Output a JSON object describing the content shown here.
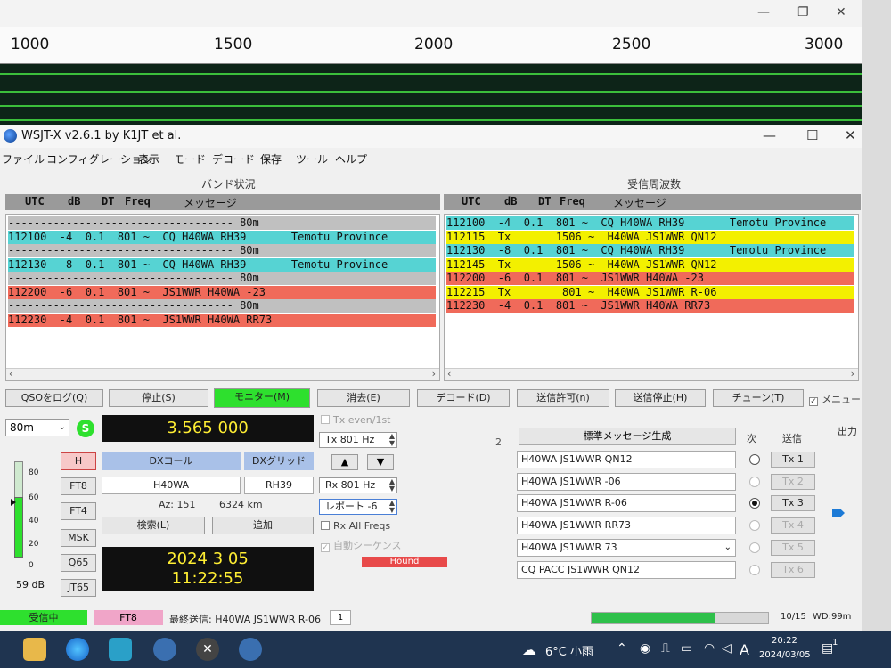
{
  "wide_graph": {
    "scale_labels": [
      "1000",
      "1500",
      "2000",
      "2500",
      "3000"
    ]
  },
  "app": {
    "title": "WSJT-X   v2.6.1   by K1JT et al."
  },
  "menu": [
    "ファイル",
    "コンフィグレーション",
    "表示",
    "モード",
    "デコード",
    "保存",
    "ツール",
    "ヘルプ"
  ],
  "band_activity": {
    "title": "バンド状況",
    "headers": {
      "utc": "UTC",
      "db": "dB",
      "dt": "DT",
      "freq": "Freq",
      "msg": "メッセージ"
    },
    "rows": [
      {
        "type": "sep",
        "text": "----------------------------------- 80m"
      },
      {
        "type": "cq",
        "text": "112100  -4  0.1  801 ~  CQ H40WA RH39       Temotu Province"
      },
      {
        "type": "sep",
        "text": "----------------------------------- 80m"
      },
      {
        "type": "cq",
        "text": "112130  -8  0.1  801 ~  CQ H40WA RH39       Temotu Province"
      },
      {
        "type": "sep",
        "text": "----------------------------------- 80m"
      },
      {
        "type": "me",
        "text": "112200  -6  0.1  801 ~  JS1WWR H40WA -23"
      },
      {
        "type": "sep",
        "text": "----------------------------------- 80m"
      },
      {
        "type": "me",
        "text": "112230  -4  0.1  801 ~  JS1WWR H40WA RR73"
      }
    ]
  },
  "rx_frequency": {
    "title": "受信周波数",
    "headers": {
      "utc": "UTC",
      "db": "dB",
      "dt": "DT",
      "freq": "Freq",
      "msg": "メッセージ"
    },
    "rows": [
      {
        "type": "cq",
        "text": "112100  -4  0.1  801 ~  CQ H40WA RH39       Temotu Province"
      },
      {
        "type": "tx",
        "text": "112115  Tx       1506 ~  H40WA JS1WWR QN12"
      },
      {
        "type": "cq",
        "text": "112130  -8  0.1  801 ~  CQ H40WA RH39       Temotu Province"
      },
      {
        "type": "tx",
        "text": "112145  Tx       1506 ~  H40WA JS1WWR QN12"
      },
      {
        "type": "me",
        "text": "112200  -6  0.1  801 ~  JS1WWR H40WA -23"
      },
      {
        "type": "tx",
        "text": "112215  Tx        801 ~  H40WA JS1WWR R-06"
      },
      {
        "type": "me",
        "text": "112230  -4  0.1  801 ~  JS1WWR H40WA RR73"
      }
    ]
  },
  "buttons": {
    "log_qso": "QSOをログ(Q)",
    "stop": "停止(S)",
    "monitor": "モニター(M)",
    "erase": "消去(E)",
    "decode": "デコード(D)",
    "enable_tx": "送信許可(n)",
    "halt_tx": "送信停止(H)",
    "tune": "チューン(T)",
    "menus": "メニュー"
  },
  "controls": {
    "band": "80m",
    "s_badge": "S",
    "dial_freq": "3.565 000",
    "h_button": "H",
    "modes": [
      "FT8",
      "FT4",
      "MSK",
      "Q65",
      "JT65"
    ],
    "meter_marks": [
      "80",
      "60",
      "40",
      "20",
      "0"
    ],
    "meter_db": "59 dB",
    "dx_call_label": "DXコール",
    "dx_grid_label": "DXグリッド",
    "dx_call": "H40WA",
    "dx_grid": "RH39",
    "az": "Az: 151",
    "dist": "6324 km",
    "lookup": "検索(L)",
    "add": "追加",
    "date": "2024 3 05",
    "time": "11:22:55",
    "tx_even": "Tx even/1st",
    "tx_freq": "Tx  801  Hz",
    "rx_freq": "Rx  801  Hz",
    "report": "レポート -6",
    "rx_all": "Rx All Freqs",
    "auto_seq": "自動シーケンス",
    "hound": "Hound",
    "up": "▲",
    "down": "▼"
  },
  "messages": {
    "gen_button": "標準メッセージ生成",
    "next_label": "次",
    "send_label": "送信",
    "output_label": "出力",
    "tab_label": "2",
    "list": [
      {
        "text": "H40WA JS1WWR QN12",
        "tx": "Tx 1",
        "selected": false,
        "enabled": true
      },
      {
        "text": "H40WA JS1WWR -06",
        "tx": "Tx 2",
        "selected": false,
        "enabled": false
      },
      {
        "text": "H40WA JS1WWR R-06",
        "tx": "Tx 3",
        "selected": true,
        "enabled": true
      },
      {
        "text": "H40WA JS1WWR RR73",
        "tx": "Tx 4",
        "selected": false,
        "enabled": false
      },
      {
        "text": "H40WA JS1WWR 73",
        "tx": "Tx 5",
        "selected": false,
        "enabled": false
      },
      {
        "text": "CQ PACC JS1WWR QN12",
        "tx": "Tx 6",
        "selected": false,
        "enabled": false
      }
    ]
  },
  "status": {
    "receiving": "受信中",
    "mode": "FT8",
    "last_tx": "最終送信: H40WA JS1WWR R-06",
    "num": "1",
    "progress": 0.7,
    "count": "10/15",
    "wd": "WD:99m"
  },
  "taskbar": {
    "weather": "6°C 小雨",
    "ime": "A",
    "clock_time": "20:22",
    "clock_date": "2024/03/05",
    "notif": "1"
  },
  "colors": {
    "cq": "#56d3d3",
    "me": "#f06a5a",
    "tx": "#f3f000",
    "monitor": "#2ee02e",
    "display": "#ffee33"
  }
}
